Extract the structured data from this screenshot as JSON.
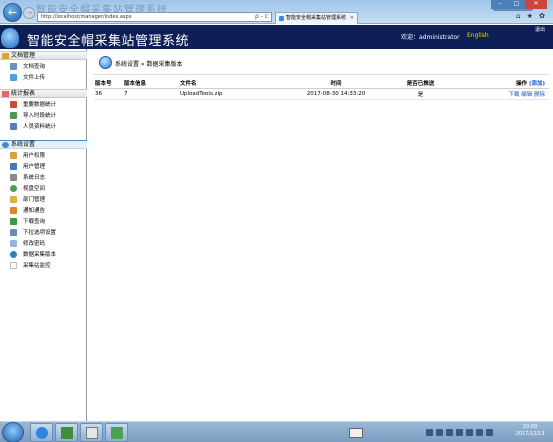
{
  "browser": {
    "url": "http://localhost/manager/index.aspx",
    "tab_title": "智能安全帽采集站管理系统",
    "tab_close": "×",
    "addr_tools": "ρ - c",
    "ie_icons": "⌂ ★ ✿"
  },
  "header": {
    "title": "智能安全帽采集站管理系统",
    "welcome": "欢迎：administrator",
    "lang": "English",
    "logout": "退出"
  },
  "sidebar": {
    "sections": [
      {
        "label": "文档管理",
        "items": [
          "文档查询",
          "文件上传"
        ]
      },
      {
        "label": "统计报表",
        "items": [
          "重要数据统计",
          "导入时段统计",
          "人员资料统计"
        ]
      },
      {
        "label": "系统设置",
        "items": [
          "用户权限",
          "用户管理",
          "系统日志",
          "视盘空间",
          "部门管理",
          "通知通告",
          "下载查询",
          "下拉选项设置",
          "修改密码",
          "数据采集版本",
          "采集站监控"
        ]
      }
    ]
  },
  "main": {
    "breadcrumb": "系统设置 » 数据采集版本",
    "table": {
      "headers": [
        "版本号",
        "版本信息",
        "文件名",
        "时间",
        "是否已推送",
        "操作"
      ],
      "add_link": "(添加)",
      "rows": [
        {
          "version": "36",
          "info": "7",
          "file": "UploadTools.zip",
          "time": "2017-08-30 14:33:20",
          "pushed": "是",
          "ops": "下载 编辑 删除"
        }
      ]
    }
  },
  "taskbar": {
    "clock_time": "20:09",
    "clock_date": "2017/12/13"
  },
  "colors": {
    "header_bg": "#0d1f56",
    "accent": "#1b55c0",
    "lang_color": "#ffd400"
  }
}
